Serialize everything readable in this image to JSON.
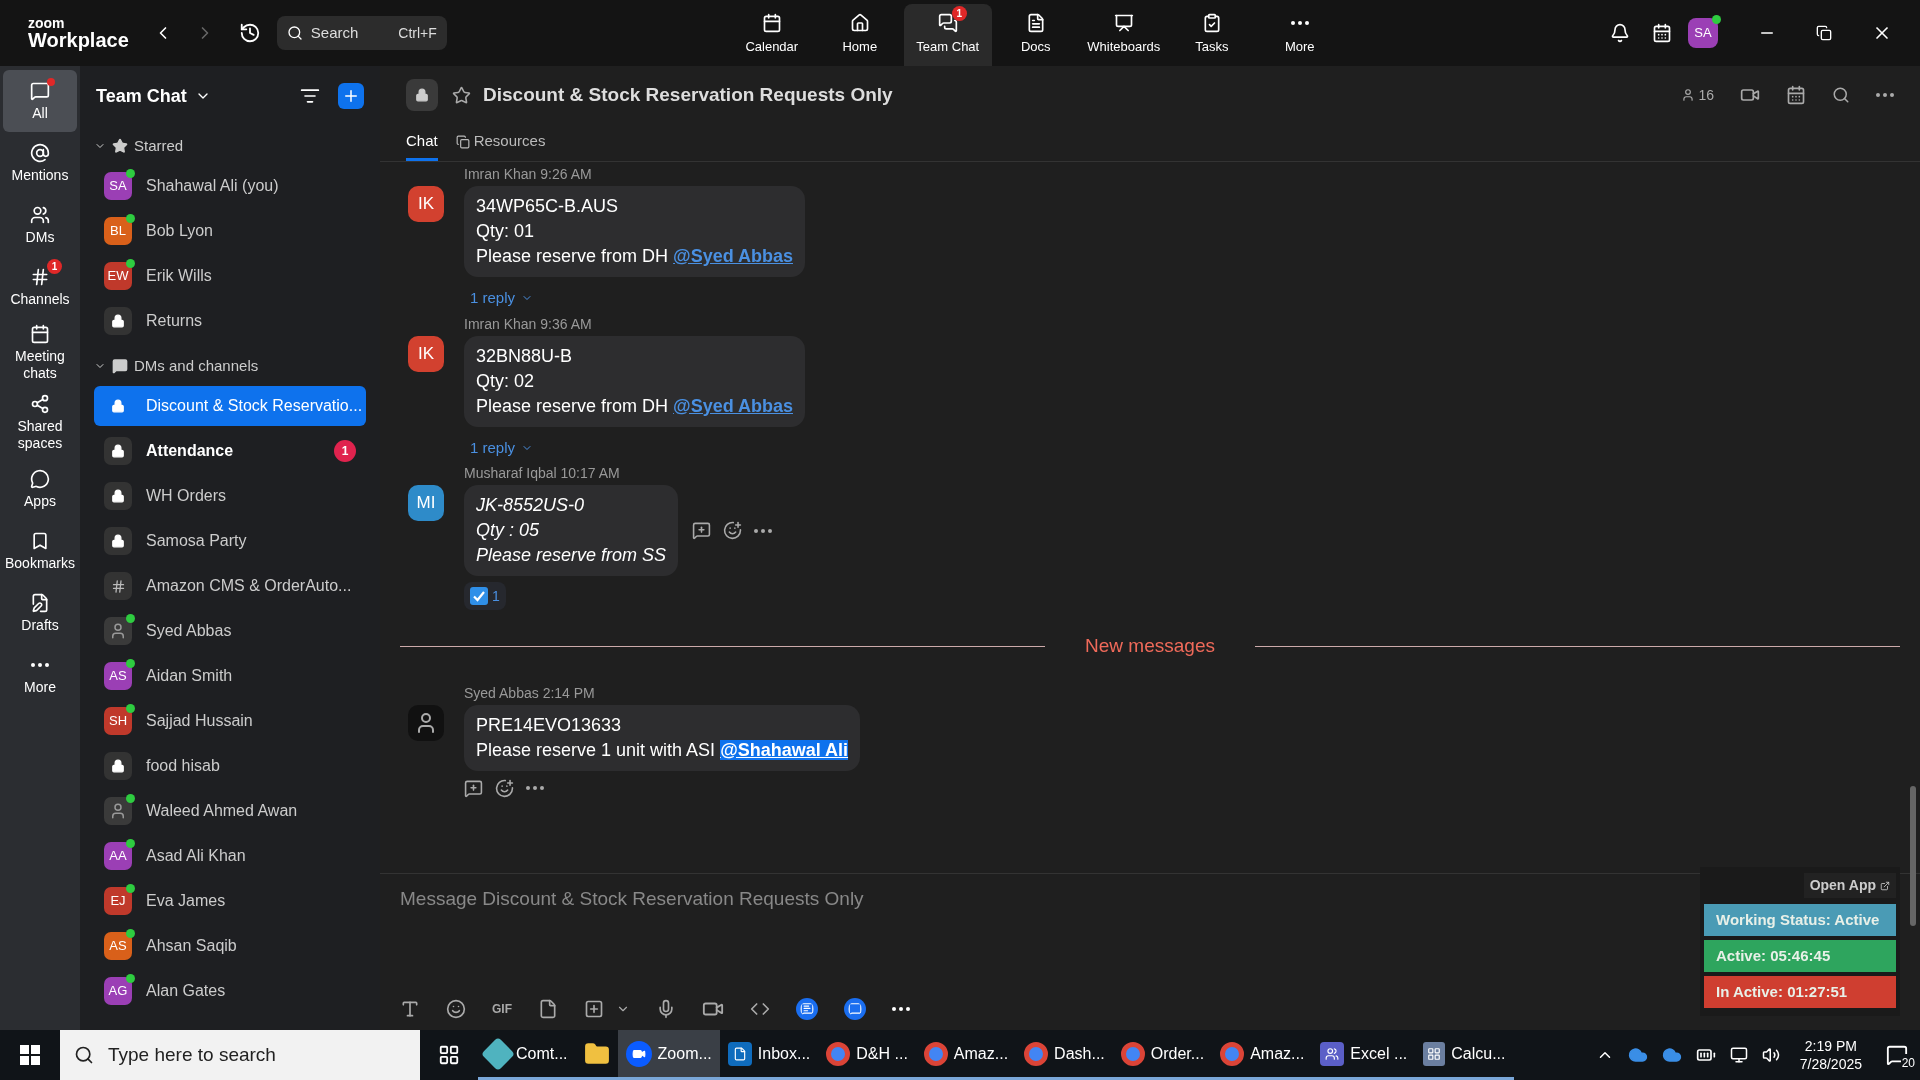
{
  "app": {
    "logo_top": "zoom",
    "logo_bottom": "Workplace",
    "search": {
      "placeholder": "Search",
      "shortcut": "Ctrl+F"
    },
    "user_initials": "SA"
  },
  "top_nav": [
    {
      "label": "Calendar",
      "selected": false
    },
    {
      "label": "Home",
      "selected": false
    },
    {
      "label": "Team Chat",
      "selected": true,
      "badge": "1"
    },
    {
      "label": "Docs",
      "selected": false
    },
    {
      "label": "Whiteboards",
      "selected": false
    },
    {
      "label": "Tasks",
      "selected": false
    },
    {
      "label": "More",
      "selected": false
    }
  ],
  "rail": [
    {
      "label": "All",
      "selected": true,
      "dot": true
    },
    {
      "label": "Mentions",
      "selected": false
    },
    {
      "label": "DMs",
      "selected": false
    },
    {
      "label": "Channels",
      "selected": false,
      "badge": "1"
    },
    {
      "label": "Meeting chats",
      "selected": false
    },
    {
      "label": "Shared spaces",
      "selected": false
    },
    {
      "label": "Apps",
      "selected": false
    },
    {
      "label": "Bookmarks",
      "selected": false
    },
    {
      "label": "Drafts",
      "selected": false
    },
    {
      "label": "More",
      "selected": false
    }
  ],
  "sidebar": {
    "title": "Team Chat",
    "sections": [
      {
        "label": "Starred",
        "kind": "star",
        "expanded": true,
        "items": [
          {
            "kind": "initials",
            "initials": "SA",
            "color": "#9b3fb5",
            "online": true,
            "name": "Shahawal Ali (you)",
            "selected": false,
            "unread": false
          },
          {
            "kind": "initials",
            "initials": "BL",
            "color": "#d9601a",
            "online": true,
            "name": "Bob Lyon",
            "selected": false,
            "unread": false
          },
          {
            "kind": "initials",
            "initials": "EW",
            "color": "#c0392b",
            "online": true,
            "name": "Erik Wills",
            "selected": false,
            "unread": false
          },
          {
            "kind": "private",
            "name": "Returns",
            "selected": false,
            "unread": false
          }
        ]
      },
      {
        "label": "DMs and channels",
        "kind": "chat",
        "expanded": true,
        "items": [
          {
            "kind": "private",
            "name": "Discount & Stock Reservatio...",
            "selected": true,
            "unread": false
          },
          {
            "kind": "private",
            "name": "Attendance",
            "selected": false,
            "unread": true,
            "badge": "1"
          },
          {
            "kind": "private",
            "name": "WH Orders",
            "selected": false,
            "unread": false
          },
          {
            "kind": "private",
            "name": "Samosa Party",
            "selected": false,
            "unread": false
          },
          {
            "kind": "public",
            "name": "Amazon CMS & OrderAuto...",
            "selected": false,
            "unread": false
          },
          {
            "kind": "photo",
            "online": true,
            "name": "Syed Abbas",
            "selected": false,
            "unread": false
          },
          {
            "kind": "initials",
            "initials": "AS",
            "color": "#9b3fb5",
            "online": true,
            "name": "Aidan Smith",
            "selected": false,
            "unread": false
          },
          {
            "kind": "initials",
            "initials": "SH",
            "color": "#c0392b",
            "online": true,
            "name": "Sajjad Hussain",
            "selected": false,
            "unread": false
          },
          {
            "kind": "private",
            "name": "food hisab",
            "selected": false,
            "unread": false
          },
          {
            "kind": "photo",
            "online": true,
            "name": "Waleed Ahmed Awan",
            "selected": false,
            "unread": false
          },
          {
            "kind": "initials",
            "initials": "AA",
            "color": "#9b3fb5",
            "online": true,
            "name": "Asad Ali Khan",
            "selected": false,
            "unread": false
          },
          {
            "kind": "initials",
            "initials": "EJ",
            "color": "#c0392b",
            "online": true,
            "name": "Eva James",
            "selected": false,
            "unread": false
          },
          {
            "kind": "initials",
            "initials": "AS",
            "color": "#d9601a",
            "online": true,
            "name": "Ahsan Saqib",
            "selected": false,
            "unread": false
          },
          {
            "kind": "initials",
            "initials": "AG",
            "color": "#9b3fb5",
            "online": true,
            "name": "Alan Gates",
            "selected": false,
            "unread": false
          }
        ]
      }
    ]
  },
  "channel": {
    "title": "Discount & Stock Reservation Requests Only",
    "members": "16",
    "tabs": [
      {
        "label": "Chat",
        "selected": true
      },
      {
        "label": "Resources",
        "selected": false
      }
    ]
  },
  "messages": [
    {
      "kind": "message",
      "avatar": {
        "kind": "initials",
        "initials": "IK",
        "color": "#d2412f"
      },
      "sender": "Imran Khan",
      "time": "9:26 AM",
      "italic": false,
      "lines": [
        "34WP65C-B.AUS",
        "Qty: 01"
      ],
      "last_line": "Please reserve from DH",
      "mention": "@Syed Abbas",
      "mention_highlighted": false,
      "replies": "1 reply"
    },
    {
      "kind": "message",
      "avatar": {
        "kind": "initials",
        "initials": "IK",
        "color": "#d2412f"
      },
      "sender": "Imran Khan",
      "time": "9:36 AM",
      "italic": false,
      "lines": [
        "32BN88U-B",
        "Qty: 02"
      ],
      "last_line": "Please reserve from DH",
      "mention": "@Syed Abbas",
      "mention_highlighted": false,
      "replies": "1 reply"
    },
    {
      "kind": "message",
      "avatar": {
        "kind": "initials",
        "initials": "MI",
        "color": "#2e8bc9"
      },
      "sender": "Musharaf Iqbal",
      "time": "10:17 AM",
      "italic": true,
      "lines": [
        "JK-8552US-0",
        "Qty : 05"
      ],
      "last_line": "Please reserve from SS",
      "hover_actions": true,
      "actions_below": false,
      "reaction": "1"
    },
    {
      "kind": "divider",
      "label": "New messages"
    },
    {
      "kind": "message",
      "avatar": {
        "kind": "photo"
      },
      "sender": "Syed Abbas",
      "time": "2:14 PM",
      "italic": false,
      "lines": [
        "PRE14EVO13633"
      ],
      "last_line": "Please reserve 1 unit with ASI",
      "mention": "@Shahawal Ali",
      "mention_highlighted": true,
      "hover_actions": true,
      "actions_below": true
    }
  ],
  "composer": {
    "placeholder": "Message Discount & Stock Reservation Requests Only",
    "gif_label": "GIF"
  },
  "widget": {
    "link": "Open App",
    "rows": [
      {
        "text": "Working Status: Active",
        "color": "#4a9bb5"
      },
      {
        "text": "Active: 05:46:45",
        "color": "#2ea55e"
      },
      {
        "text": "In Active: 01:27:51",
        "color": "#cf3e30"
      }
    ]
  },
  "taskbar": {
    "search_placeholder": "Type here to search",
    "apps": [
      {
        "kind": "generic",
        "label": "Comt...",
        "selected": false
      },
      {
        "kind": "folder",
        "selected": false
      },
      {
        "kind": "zoom",
        "label": "Zoom...",
        "selected": true
      },
      {
        "kind": "outlook",
        "label": "Inbox...",
        "selected": false
      },
      {
        "kind": "chrome",
        "label": "D&H ...",
        "selected": false
      },
      {
        "kind": "chrome",
        "label": "Amaz...",
        "selected": false
      },
      {
        "kind": "chrome",
        "label": "Dash...",
        "selected": false
      },
      {
        "kind": "chrome",
        "label": "Order...",
        "selected": false
      },
      {
        "kind": "chrome",
        "label": "Amaz...",
        "selected": false
      },
      {
        "kind": "teams",
        "label": "Excel ...",
        "selected": false
      },
      {
        "kind": "calculator",
        "label": "Calcu...",
        "selected": false
      }
    ],
    "time": "2:19 PM",
    "date": "7/28/2025",
    "notifications": "20"
  }
}
